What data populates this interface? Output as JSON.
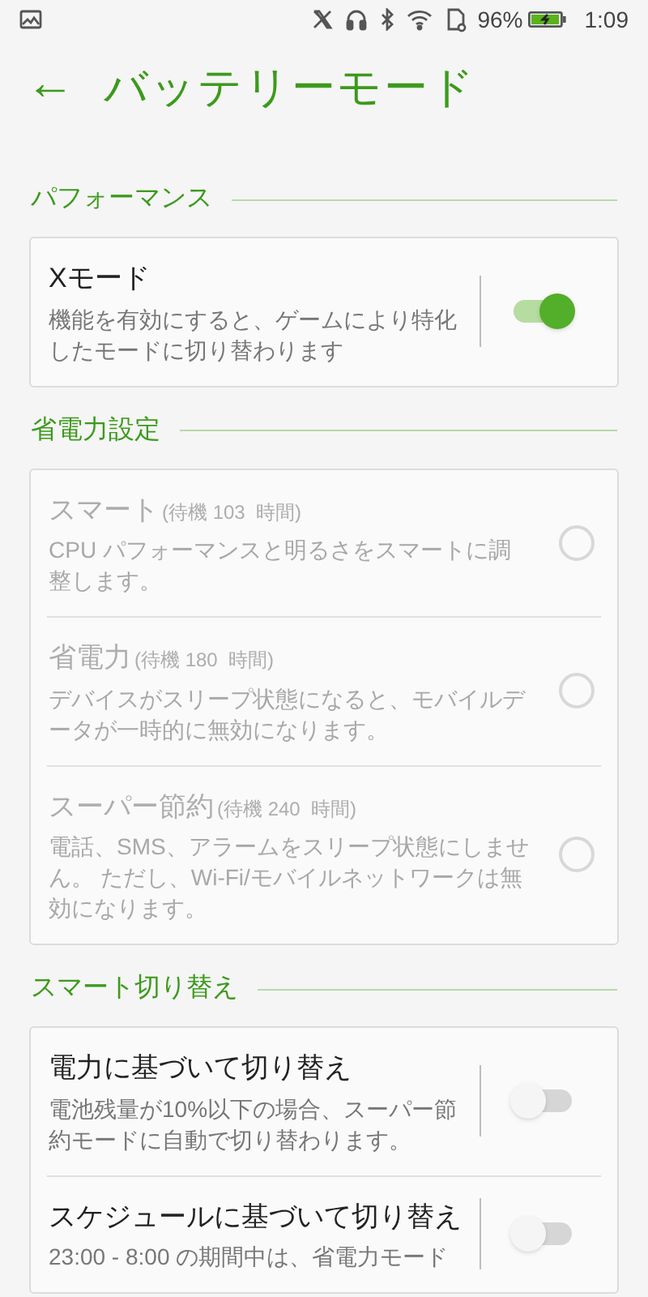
{
  "status_bar": {
    "battery_percent": "96%",
    "time": "1:09"
  },
  "header": {
    "back": "←",
    "title": "バッテリーモード"
  },
  "sections": [
    {
      "title": "パフォーマンス",
      "items": [
        {
          "kind": "toggle",
          "title": "Xモード",
          "description": "機能を有効にすると、ゲームにより特化したモードに切り替わります",
          "on": true,
          "disabled": false
        }
      ]
    },
    {
      "title": "省電力設定",
      "items": [
        {
          "kind": "radio",
          "title": "スマート",
          "standby": "(待機 103  時間)",
          "description": "CPU パフォーマンスと明るさをスマートに調整します。",
          "selected": false,
          "disabled": true
        },
        {
          "kind": "radio",
          "title": "省電力",
          "standby": "(待機 180  時間)",
          "description": "デバイスがスリープ状態になると、モバイルデータが一時的に無効になります。",
          "selected": false,
          "disabled": true
        },
        {
          "kind": "radio",
          "title": "スーパー節約",
          "standby": "(待機 240  時間)",
          "description": "電話、SMS、アラームをスリープ状態にしません。 ただし、Wi-Fi/モバイルネットワークは無効になります。",
          "selected": false,
          "disabled": true
        }
      ]
    },
    {
      "title": "スマート切り替え",
      "items": [
        {
          "kind": "toggle",
          "title": "電力に基づいて切り替え",
          "description": "電池残量が10%以下の場合、スーパー節約モードに自動で切り替わります。",
          "on": false,
          "disabled": false
        },
        {
          "kind": "toggle",
          "title": "スケジュールに基づいて切り替え",
          "description": "23:00 - 8:00 の期間中は、省電力モード",
          "on": false,
          "disabled": false
        }
      ]
    }
  ]
}
